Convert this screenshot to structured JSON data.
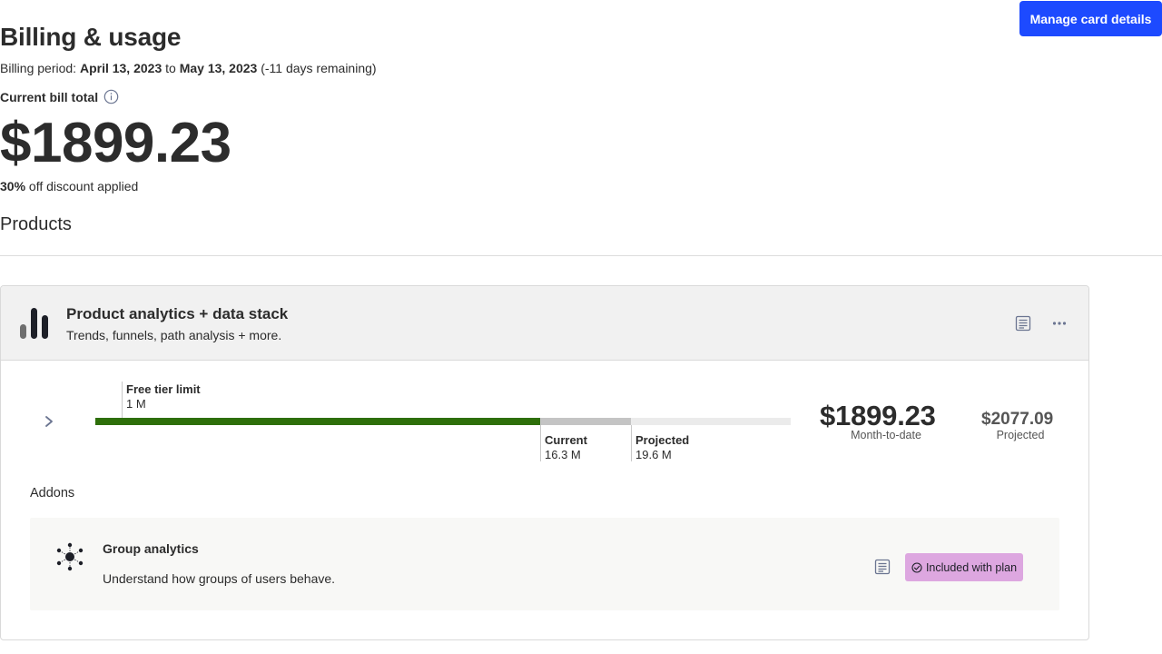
{
  "header": {
    "manage_button": "Manage card details",
    "title": "Billing & usage",
    "billing_period": {
      "label": "Billing period:",
      "start": "April 13, 2023",
      "to": "to",
      "end": "May 13, 2023",
      "remaining": "(-11 days remaining)"
    }
  },
  "bill": {
    "total_label": "Current bill total",
    "amount": "$1899.23",
    "discount_value": "30%",
    "discount_text": "off discount applied"
  },
  "products": {
    "heading": "Products",
    "items": [
      {
        "title": "Product analytics + data stack",
        "description": "Trends, funnels, path analysis + more.",
        "usage": {
          "free_tier_label": "Free tier limit",
          "free_tier_value": "1 M",
          "current_label": "Current",
          "current_value": "16.3 M",
          "projected_label": "Projected",
          "projected_value": "19.6 M",
          "current_fraction": 0.64,
          "projected_fraction": 0.77
        },
        "month_to_date_amount": "$1899.23",
        "month_to_date_label": "Month-to-date",
        "projected_amount": "$2077.09",
        "projected_label": "Projected",
        "addons_heading": "Addons",
        "addons": [
          {
            "title": "Group analytics",
            "description": "Understand how groups of users behave.",
            "badge": "Included with plan",
            "badge_color": "#dda7e0"
          }
        ]
      }
    ]
  },
  "colors": {
    "primary": "#1d4aff",
    "usage_current": "#2e6f0a",
    "usage_projected": "#c4c4c4",
    "usage_track": "#ebebeb"
  },
  "icons": {
    "info": "info-icon",
    "product": "bar-chart-icon",
    "doc": "document-icon",
    "more": "more-horizontal-icon",
    "expand": "chevron-right-icon",
    "addon": "network-icon",
    "check": "check-circle-icon"
  }
}
